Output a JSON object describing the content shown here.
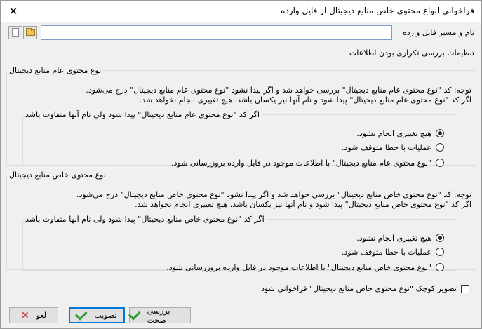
{
  "window": {
    "title": "فراخوانی انواع محتوی خاص منابع دیجیتال از فایل وارده",
    "close_glyph": "✕"
  },
  "file": {
    "label": "نام و مسیر فایل وارده",
    "value": ""
  },
  "icons": {
    "new": "document-icon",
    "open": "folder-icon"
  },
  "settings_heading": "تنظیمات بررسی تکراری بودن اطلاعات",
  "general_group": {
    "legend": "نوع محتوی عام منابع دیجیتال",
    "note_line1": "توجه: کد \"نوع محتوی عام منابع دیجیتال\" بررسی خواهد شد و اگر پیدا نشود \"نوع محتوی عام منابع دیجیتال\" درج می‌شود.",
    "note_line2": "اگر کد \"نوع محتوی عام منابع دیجیتال\" پیدا شود و نام آنها نیز یکسان باشد، هیچ تغییری انجام نخواهد شد.",
    "sub_legend": "اگر کد \"نوع محتوی عام منابع دیجیتال\" پیدا شود ولی نام آنها متفاوت باشد",
    "options": [
      {
        "label": "هیچ تغییری انجام نشود.",
        "checked": true
      },
      {
        "label": "عملیات با خطا متوقف شود.",
        "checked": false
      },
      {
        "label": "\"نوع محتوی عام منابع دیجیتال\" با اطلاعات موجود در فایل وارده بروزرسانی شود.",
        "checked": false
      }
    ]
  },
  "specific_group": {
    "legend": "نوع محتوی خاص منابع دیجیتال",
    "note_line1": "توجه: کد \"نوع محتوی خاص منابع دیجیتال\" بررسی خواهد شد و اگر پیدا نشود \"نوع محتوی خاص منابع دیجیتال\" درج می‌شود.",
    "note_line2": "اگر کد \"نوع محتوی خاص منابع دیجیتال\" پیدا شود و نام آنها نیز یکسان باشد، هیچ تغییری انجام نخواهد شد.",
    "sub_legend": "اگر کد \"نوع محتوی خاص منابع دیجیتال\" پیدا شود ولی نام آنها متفاوت باشد",
    "options": [
      {
        "label": "هیچ تغییری انجام نشود.",
        "checked": true
      },
      {
        "label": "عملیات با خطا متوقف شود.",
        "checked": false
      },
      {
        "label": "\"نوع محتوی خاص منابع دیجیتال\" با اطلاعات موجود در فایل وارده بروزرسانی شود.",
        "checked": false
      }
    ]
  },
  "thumbnail_checkbox": {
    "label": "تصویر کوچک \"نوع محتوی خاص منابع دیجیتال\" فراخوانی شود",
    "checked": false
  },
  "buttons": {
    "check": "بررسی صحت",
    "approve": "تصویب",
    "cancel": "لغو"
  },
  "colors": {
    "focus_border": "#0078d7",
    "check_green": "#2f9a2f",
    "cancel_red": "#c8191a"
  }
}
